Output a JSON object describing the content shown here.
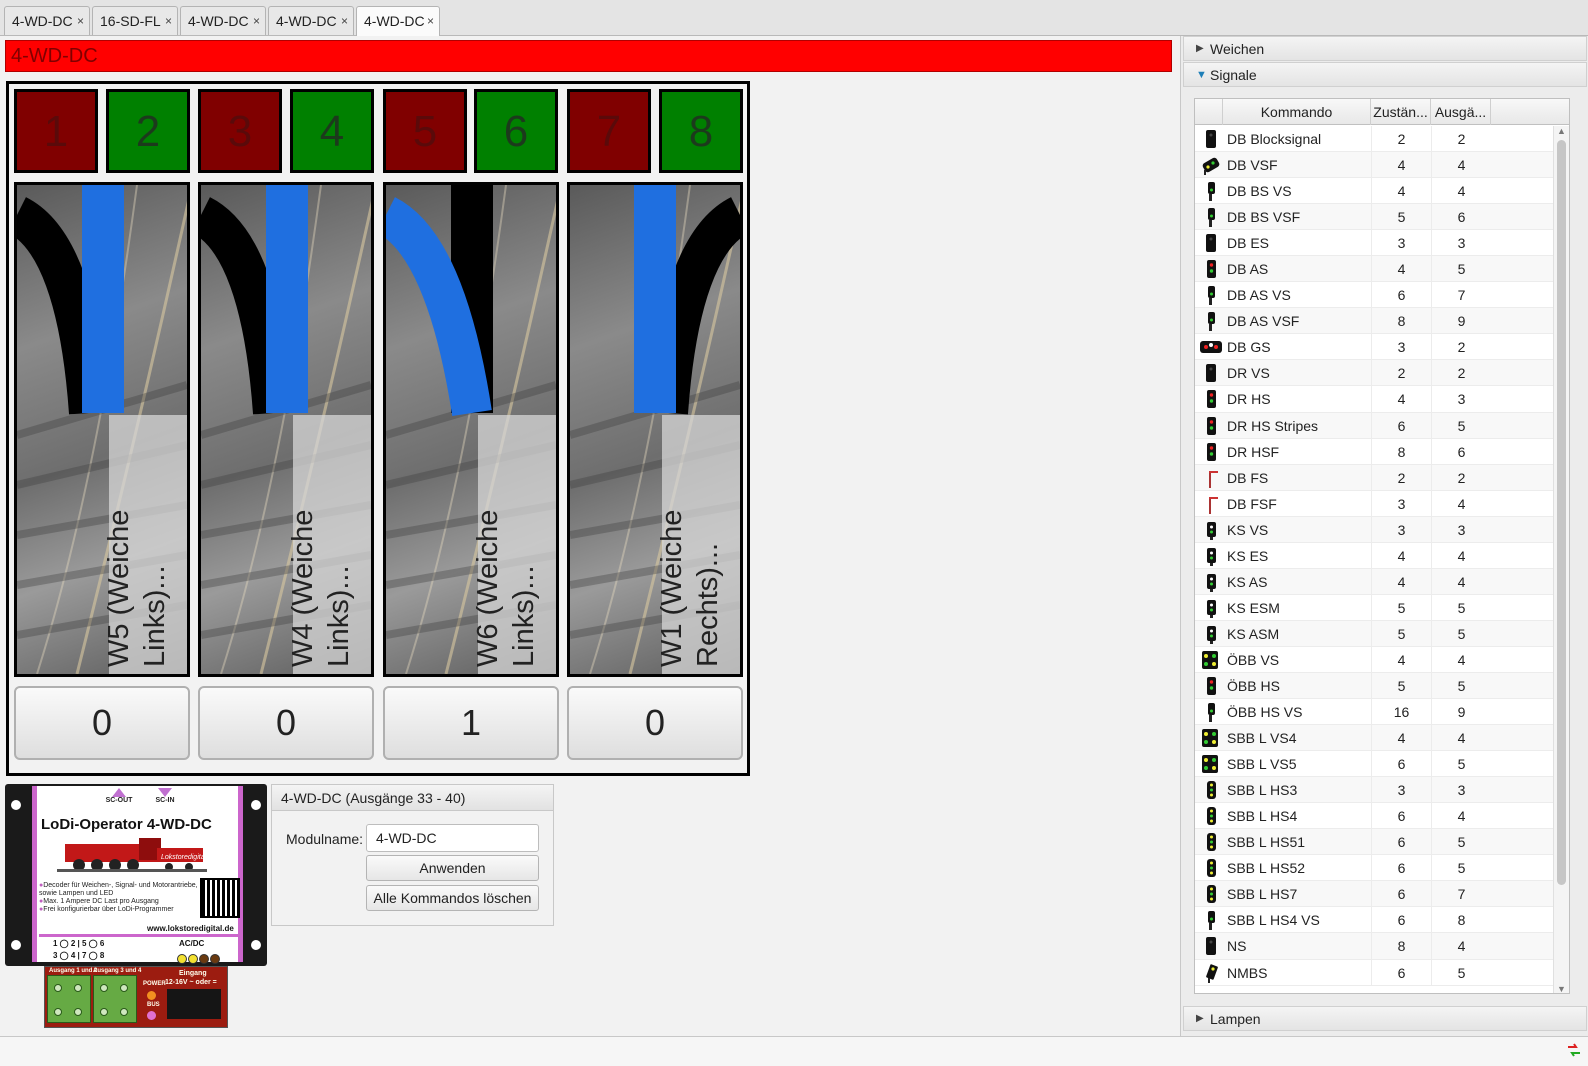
{
  "tabs": [
    {
      "label": "4-WD-DC",
      "close": "×",
      "active": false
    },
    {
      "label": "16-SD-FL",
      "close": "×",
      "active": false
    },
    {
      "label": "4-WD-DC",
      "close": "×",
      "active": false
    },
    {
      "label": "4-WD-DC",
      "close": "×",
      "active": false
    },
    {
      "label": "4-WD-DC",
      "close": "×",
      "active": true
    }
  ],
  "module_title": "4-WD-DC",
  "colors": {
    "title_bg": "#ff0000",
    "status_red": "#800000",
    "status_green": "#008000",
    "active_route": "#1f6fe0",
    "inactive_route": "#000000"
  },
  "status_cells": [
    {
      "label": "1",
      "state": "red"
    },
    {
      "label": "2",
      "state": "green"
    },
    {
      "label": "3",
      "state": "red"
    },
    {
      "label": "4",
      "state": "green"
    },
    {
      "label": "5",
      "state": "red"
    },
    {
      "label": "6",
      "state": "green"
    },
    {
      "label": "7",
      "state": "red"
    },
    {
      "label": "8",
      "state": "green"
    }
  ],
  "turnouts": [
    {
      "label": "W5 (Weiche Links)...",
      "direction": "left",
      "active_route": "straight",
      "value": "0"
    },
    {
      "label": "W4 (Weiche Links)...",
      "direction": "left",
      "active_route": "straight",
      "value": "0"
    },
    {
      "label": "W6 (Weiche Links)...",
      "direction": "left",
      "active_route": "curved",
      "value": "1"
    },
    {
      "label": "W1 (Weiche Rechts)...",
      "direction": "right",
      "active_route": "straight",
      "value": "0"
    }
  ],
  "module_image": {
    "sc_out": "SC-OUT",
    "sc_in": "SC-IN",
    "title": "LoDi-Operator  4-WD-DC",
    "brand": "Lokstoredigital",
    "description": [
      "Decoder für Weichen-, Signal- und Motorantriebe, sowie Lampen und LED",
      "Max. 1 Ampere DC Last pro Ausgang",
      "Frei konfigurierbar über LoDi-Programmer"
    ],
    "url": "www.lokstoredigital.de",
    "outputs_row1": "1 ◯ 2 | 5 ◯ 6",
    "outputs_row2": "3 ◯ 4 | 7 ◯ 8",
    "acdc": "AC/DC",
    "terminal_labels": [
      "Ausgang 1 und 2",
      "Ausgang 3 und 4"
    ],
    "power": "POWER",
    "bus": "BUS",
    "input": "Eingang",
    "input_voltage": "12-16V ~ oder ="
  },
  "settings": {
    "header": "4-WD-DC (Ausgänge 33 - 40)",
    "module_name_label": "Modulname:",
    "module_name_value": "4-WD-DC",
    "apply_button": "Anwenden",
    "delete_button": "Alle Kommandos löschen"
  },
  "accordion": {
    "weichen": "Weichen",
    "signale": "Signale",
    "lampen": "Lampen",
    "collapsed_glyph": "▶",
    "expanded_glyph": "▼"
  },
  "table": {
    "headers": [
      "Kommando",
      "Zustän...",
      "Ausgä..."
    ],
    "rows": [
      {
        "icon": "signal-dark-icon",
        "name": "DB Blocksignal",
        "states": "2",
        "outputs": "2"
      },
      {
        "icon": "signal-vsf-icon",
        "name": "DB VSF",
        "states": "4",
        "outputs": "4"
      },
      {
        "icon": "signal-small-icon",
        "name": "DB BS VS",
        "states": "4",
        "outputs": "4"
      },
      {
        "icon": "signal-small-icon",
        "name": "DB BS VSF",
        "states": "5",
        "outputs": "6"
      },
      {
        "icon": "signal-dark-icon",
        "name": "DB ES",
        "states": "3",
        "outputs": "3"
      },
      {
        "icon": "signal-red-green-icon",
        "name": "DB AS",
        "states": "4",
        "outputs": "5"
      },
      {
        "icon": "signal-small-icon",
        "name": "DB AS VS",
        "states": "6",
        "outputs": "7"
      },
      {
        "icon": "signal-small-icon",
        "name": "DB AS VSF",
        "states": "8",
        "outputs": "9"
      },
      {
        "icon": "signal-gs-icon",
        "name": "DB GS",
        "states": "3",
        "outputs": "2"
      },
      {
        "icon": "signal-dark-icon",
        "name": "DR VS",
        "states": "2",
        "outputs": "2"
      },
      {
        "icon": "signal-red-green-icon",
        "name": "DR HS",
        "states": "4",
        "outputs": "3"
      },
      {
        "icon": "signal-red-green-icon",
        "name": "DR HS Stripes",
        "states": "6",
        "outputs": "5"
      },
      {
        "icon": "signal-red-green-icon",
        "name": "DR HSF",
        "states": "8",
        "outputs": "6"
      },
      {
        "icon": "signal-semaphore-icon",
        "name": "DB FS",
        "states": "2",
        "outputs": "2"
      },
      {
        "icon": "signal-semaphore-icon",
        "name": "DB FSF",
        "states": "3",
        "outputs": "4"
      },
      {
        "icon": "signal-ks-icon",
        "name": "KS VS",
        "states": "3",
        "outputs": "3"
      },
      {
        "icon": "signal-ks-icon",
        "name": "KS ES",
        "states": "4",
        "outputs": "4"
      },
      {
        "icon": "signal-ks-icon",
        "name": "KS AS",
        "states": "4",
        "outputs": "4"
      },
      {
        "icon": "signal-ks-icon",
        "name": "KS ESM",
        "states": "5",
        "outputs": "5"
      },
      {
        "icon": "signal-ks-icon",
        "name": "KS ASM",
        "states": "5",
        "outputs": "5"
      },
      {
        "icon": "signal-obb-icon",
        "name": "ÖBB VS",
        "states": "4",
        "outputs": "4"
      },
      {
        "icon": "signal-red-green-icon",
        "name": "ÖBB HS",
        "states": "5",
        "outputs": "5"
      },
      {
        "icon": "signal-small-icon",
        "name": "ÖBB HS VS",
        "states": "16",
        "outputs": "9"
      },
      {
        "icon": "signal-obb-icon",
        "name": "SBB L VS4",
        "states": "4",
        "outputs": "4"
      },
      {
        "icon": "signal-obb-icon",
        "name": "SBB L VS5",
        "states": "6",
        "outputs": "5"
      },
      {
        "icon": "signal-sbb-icon",
        "name": "SBB L HS3",
        "states": "3",
        "outputs": "3"
      },
      {
        "icon": "signal-sbb-icon",
        "name": "SBB L HS4",
        "states": "6",
        "outputs": "4"
      },
      {
        "icon": "signal-sbb-icon",
        "name": "SBB L HS51",
        "states": "6",
        "outputs": "5"
      },
      {
        "icon": "signal-sbb-icon",
        "name": "SBB L HS52",
        "states": "6",
        "outputs": "5"
      },
      {
        "icon": "signal-sbb-icon",
        "name": "SBB L HS7",
        "states": "6",
        "outputs": "7"
      },
      {
        "icon": "signal-small-icon",
        "name": "SBB L HS4 VS",
        "states": "6",
        "outputs": "8"
      },
      {
        "icon": "signal-dark-icon",
        "name": "NS",
        "states": "8",
        "outputs": "4"
      },
      {
        "icon": "signal-nmbs-icon",
        "name": "NMBS",
        "states": "6",
        "outputs": "5"
      }
    ],
    "scroll_up": "▲",
    "scroll_down": "▼"
  }
}
